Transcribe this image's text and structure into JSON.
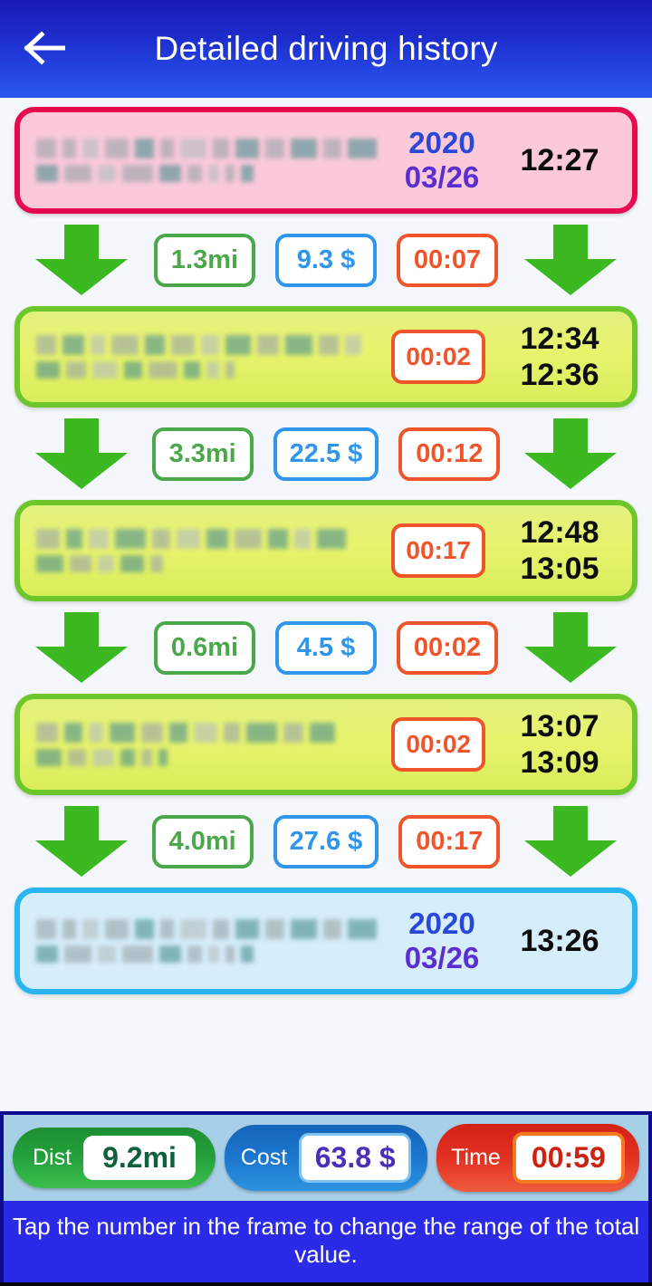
{
  "header": {
    "title": "Detailed driving history",
    "back_icon": "arrow-left-icon"
  },
  "timeline": {
    "start_card": {
      "kind": "start",
      "address_redacted": true,
      "year": "2020",
      "month_day": "03/26",
      "time": "12:27"
    },
    "end_card": {
      "kind": "end",
      "address_redacted": true,
      "year": "2020",
      "month_day": "03/26",
      "time": "13:26"
    },
    "segments": [
      {
        "distance": "1.3mi",
        "cost": "9.3 $",
        "duration": "00:07",
        "arrow_icon": "arrow-down-icon"
      },
      {
        "distance": "3.3mi",
        "cost": "22.5 $",
        "duration": "00:12",
        "arrow_icon": "arrow-down-icon"
      },
      {
        "distance": "0.6mi",
        "cost": "4.5 $",
        "duration": "00:02",
        "arrow_icon": "arrow-down-icon"
      },
      {
        "distance": "4.0mi",
        "cost": "27.6 $",
        "duration": "00:17",
        "arrow_icon": "arrow-down-icon"
      }
    ],
    "stops": [
      {
        "address_redacted": true,
        "stay_duration": "00:02",
        "arrive_time": "12:34",
        "depart_time": "12:36"
      },
      {
        "address_redacted": true,
        "stay_duration": "00:17",
        "arrive_time": "12:48",
        "depart_time": "13:05"
      },
      {
        "address_redacted": true,
        "stay_duration": "00:02",
        "arrive_time": "13:07",
        "depart_time": "13:09"
      }
    ]
  },
  "totals": {
    "distance": {
      "label": "Dist",
      "value": "9.2mi"
    },
    "cost": {
      "label": "Cost",
      "value": "63.8 $"
    },
    "time": {
      "label": "Time",
      "value": "00:59"
    }
  },
  "hint": "Tap the number in the frame to change the range of the total value.",
  "colors": {
    "appbar_blue": "#2445e2",
    "start_border": "#e60a50",
    "start_fill": "#fbc9da",
    "end_border": "#29b6ef",
    "end_fill": "#d6edfa",
    "stay_border": "#6dc72c",
    "stay_fill": "#e8f36d",
    "arrow_green": "#3cb821",
    "dist_green": "#4aa84a",
    "cost_blue": "#2f96eb",
    "time_orange": "#f0542a",
    "date_year_blue": "#2a48d8",
    "date_md_purple": "#5b2fcf",
    "page_bg": "#f4f8fd",
    "bottom_strip": "#a8cfe8",
    "hint_bg": "#2a2ae8"
  }
}
